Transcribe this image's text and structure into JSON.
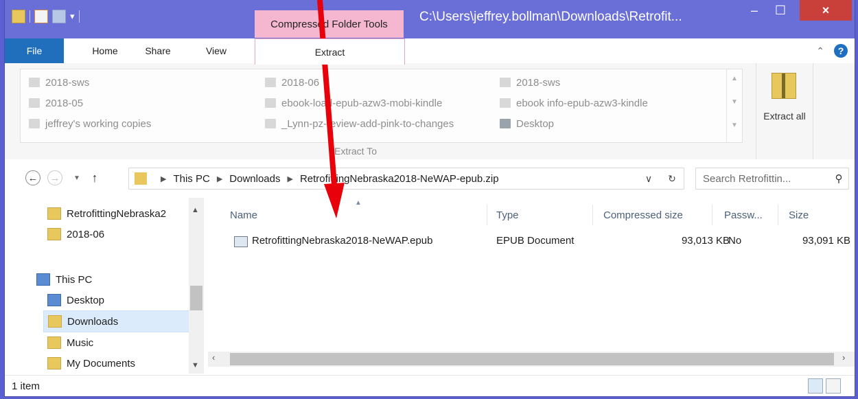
{
  "window": {
    "title": "C:\\Users\\jeffrey.bollman\\Downloads\\Retrofit...",
    "context_tab": "Compressed Folder Tools",
    "min": "–",
    "max": "☐",
    "close": "×"
  },
  "ribbon_tabs": {
    "file": "File",
    "home": "Home",
    "share": "Share",
    "view": "View",
    "extract": "Extract"
  },
  "extract_to": {
    "items": [
      "2018-sws",
      "2018-05",
      "jeffrey's working copies",
      "2018-06",
      "ebook-load-epub-azw3-mobi-kindle",
      "_Lynn-pz-review-add-pink-to-changes",
      "2018-sws",
      "ebook info-epub-azw3-kindle",
      "Desktop"
    ],
    "group_label": "Extract To",
    "extract_all_label": "Extract all"
  },
  "address": {
    "crumbs": [
      "This PC",
      "Downloads",
      "RetrofittingNebraska2018-NeWAP-epub.zip"
    ],
    "search_placeholder": "Search Retrofittin..."
  },
  "nav_pane": {
    "items": [
      "RetrofittingNebraska2",
      "2018-06",
      "This PC",
      "Desktop",
      "Downloads",
      "Music",
      "My Documents"
    ]
  },
  "columns": [
    "Name",
    "Type",
    "Compressed size",
    "Passw...",
    "Size"
  ],
  "files": [
    {
      "name": "RetrofittingNebraska2018-NeWAP.epub",
      "type": "EPUB Document",
      "compressed_size": "93,013 KB",
      "password": "No",
      "size": "93,091 KB"
    }
  ],
  "status": {
    "count": "1 item"
  },
  "annotation_color": "#e8000a"
}
